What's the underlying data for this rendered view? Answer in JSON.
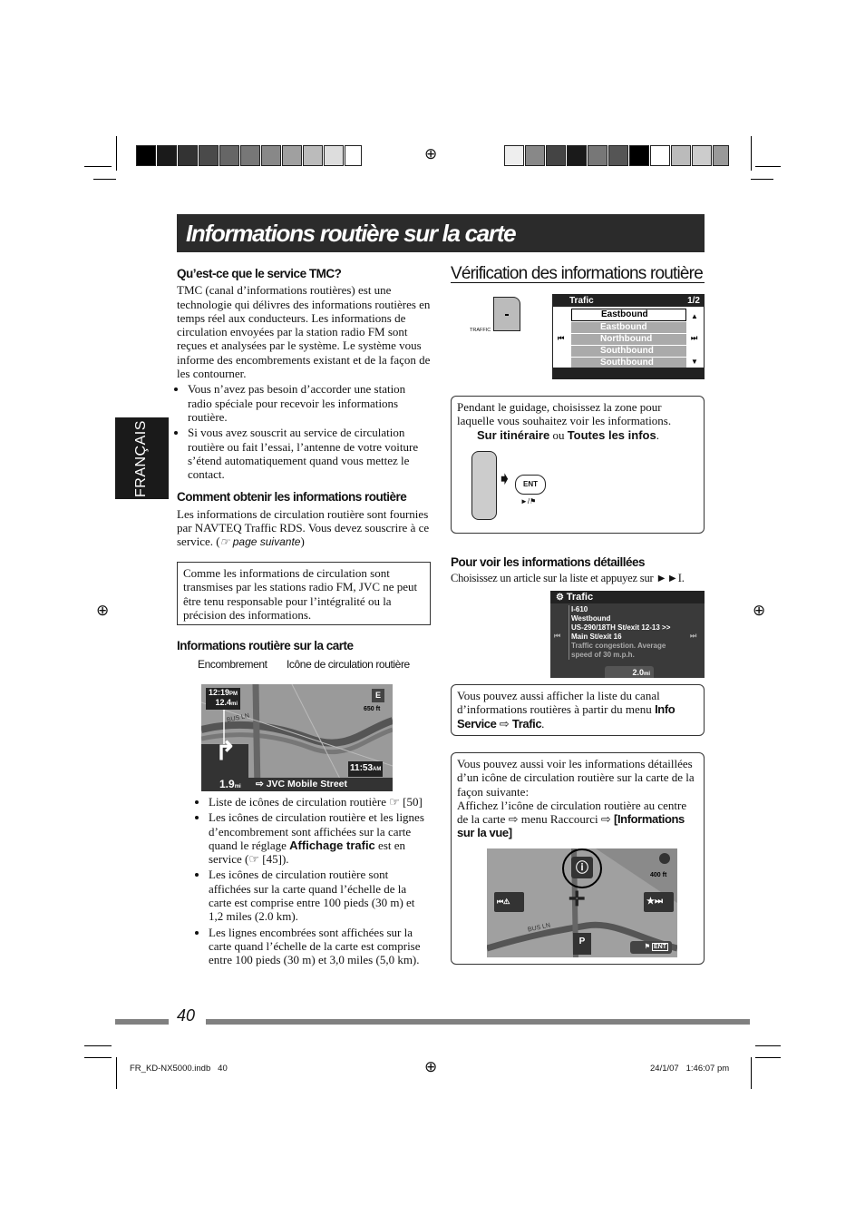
{
  "header": {
    "title": "Informations routière sur la carte",
    "side_tab": "FRANÇAIS"
  },
  "left": {
    "s1_title": "Qu’est-ce que le service TMC?",
    "s1_text": "TMC (canal d’informations routières) est une technologie qui délivres des informations routières en temps réel aux conducteurs. Les informations de circulation envoyées par la station radio FM sont reçues et analysées par le système. Le système vous informe des encombrements existant et de la façon de les contourner.",
    "s1_bullets": [
      "Vous n’avez pas besoin d’accorder une station radio spéciale pour recevoir les informations routière.",
      "Si vous avez souscrit au service de circulation routière ou fait l’essai, l’antenne de votre voiture s’étend automatiquement quand vous mettez le contact."
    ],
    "s2_title": "Comment obtenir les informations routière",
    "s2_text": "Les informations de circulation routière sont fournies par NAVTEQ Traffic RDS. Vous devez souscrire à ce service. (",
    "s2_ref": "☞ page suivante",
    "s2_close": ")",
    "note": "Comme les informations de circulation sont transmises par les stations radio FM, JVC ne peut être tenu responsable pour l’intégralité ou la précision des informations.",
    "s3_title": "Informations routière sur la carte",
    "label_encombrement": "Encombrement",
    "label_icone": "Icône de circulation routière",
    "map": {
      "time": "12:19",
      "time_suffix": "PM",
      "dist": "12.4",
      "dist_unit": "mi",
      "compass": "E",
      "scale": "650 ft",
      "road": "BUS LN",
      "clock": "11:53",
      "clock_suffix": "AM",
      "turn_dist": "1.9",
      "turn_unit": "mi",
      "street": "JVC Mobile Street"
    },
    "b1": "Liste de icônes de circulation routière ☞ [50]",
    "b2_a": "Les icônes de circulation routière et les lignes d’encombrement sont affichées sur la carte quand le réglage ",
    "b2_bold": "Affichage trafic",
    "b2_b": " est en service (☞ [45]).",
    "b3": "Les icônes de circulation routière sont affichées sur la carte quand l’échelle de la carte est comprise entre 100 pieds (30 m) et 1,2 miles (2.0 km).",
    "b4": "Les lignes encombrées sont affichées sur la carte quand l’échelle de la carte est comprise entre 100 pieds (30 m) et 3,0 miles (5,0 km)."
  },
  "right": {
    "title": "Vérification des informations routière",
    "traffic_button": "TRAFFIC",
    "trafic_screen": {
      "title": "Trafic",
      "page": "1/2",
      "rows": [
        "Eastbound",
        "Eastbound",
        "Northbound",
        "Southbound",
        "Southbound"
      ]
    },
    "guide_text": "Pendant le guidage, choisissez la zone pour laquelle vous souhaitez voir les informations.",
    "opt1": "Sur itinéraire",
    "ou": " ou ",
    "opt2": "Toutes les infos",
    "dot": ".",
    "ent": "ENT",
    "ent_sub": "►/⚑",
    "s2_title": "Pour voir les informations détaillées",
    "s2_text": "Choisissez un article sur la liste et appuyez sur ►►I.",
    "detail_screen": {
      "title": "Trafic",
      "lines": [
        "I-610",
        "Westbound",
        "US-290/18TH St/exit 12-13 >>",
        "Main St/exit 16"
      ],
      "desc": "Traffic congestion. Average speed of 30 m.p.h.",
      "dist": "2.0",
      "unit": "mi"
    },
    "box2_text": "Vous pouvez aussi afficher la liste du canal d’informations routières à partir du menu ",
    "box2_bold1": "Info Service",
    "arrow": " ⇨ ",
    "box2_bold2": "Trafic",
    "box3_text": "Vous pouvez aussi voir les informations détaillées d’un icône de circulation routière sur la carte de la façon suivante:",
    "box3_text2": "Affichez l’icône de circulation routière au centre de la carte ⇨ menu Raccourci ⇨ ",
    "box3_bold": "[Informations sur la vue]",
    "map2": {
      "scale": "400 ft",
      "road": "BUS LN",
      "ent": "ENT"
    }
  },
  "footer": {
    "page_number": "40",
    "file": "FR_KD-NX5000.indb   40",
    "date": "24/1/07   1:46:07 pm"
  },
  "colors": {
    "title_bar": "#2b2b2b",
    "footer_bar": "#808080"
  }
}
